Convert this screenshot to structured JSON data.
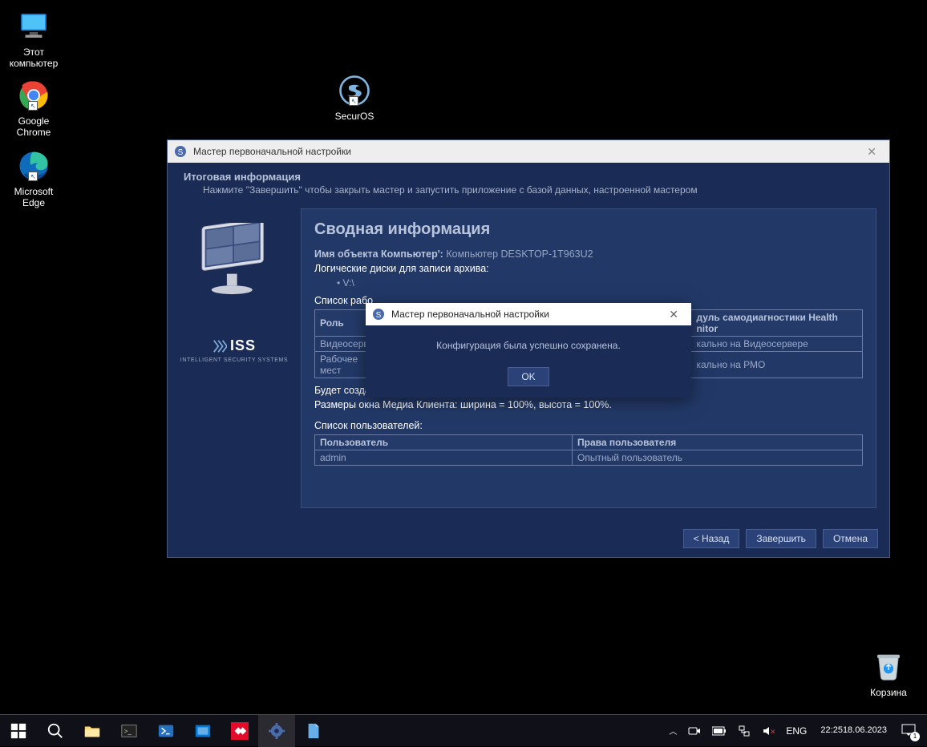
{
  "desktop": {
    "icons": [
      {
        "name": "this-pc",
        "label": "Этот\nкомпьютер"
      },
      {
        "name": "chrome",
        "label": "Google\nChrome"
      },
      {
        "name": "edge",
        "label": "Microsoft\nEdge"
      },
      {
        "name": "securos",
        "label": "SecurOS"
      }
    ],
    "recycle_label": "Корзина"
  },
  "wizard": {
    "window_title": "Мастер первоначальной настройки",
    "header_title": "Итоговая информация",
    "header_desc": "Нажмите \"Завершить\" чтобы закрыть мастер и запустить приложение с базой данных, настроенной мастером",
    "brand": "ISS",
    "brand_sub": "INTELLIGENT SECURITY SYSTEMS",
    "summary_title": "Сводная информация",
    "computer_name_label": "Имя объекта Компьютер':",
    "computer_name_value": "Компьютер DESKTOP-1T963U2",
    "drives_label": "Логические диски для записи архива:",
    "drives_value": "V:\\",
    "roles_label": "Список рабо",
    "roles_table": {
      "headers": [
        "Роль",
        "",
        "дуль самодиагностики Health\nnitor"
      ],
      "rows": [
        [
          "Видеосервер",
          "",
          "кально на Видеосервере"
        ],
        [
          "Рабочее мест",
          "",
          "кально на РМО"
        ]
      ]
    },
    "media_client_line1": "Будет создан Медиа Клиент со всеми сконфигурированными Камерами.",
    "media_client_line2": "Размеры окна Медиа Клиента: ширина = 100%, высота = 100%.",
    "users_label": "Список пользователей:",
    "users_table": {
      "headers": [
        "Пользователь",
        "Права пользователя"
      ],
      "rows": [
        [
          "admin",
          "Опытный пользователь"
        ]
      ]
    },
    "buttons": {
      "back": "< Назад",
      "finish": "Завершить",
      "cancel": "Отмена"
    }
  },
  "modal": {
    "title": "Мастер первоначальной настройки",
    "message": "Конфигурация была успешно сохранена.",
    "ok": "OK"
  },
  "taskbar": {
    "lang": "ENG",
    "time": "22:25",
    "date": "18.06.2023",
    "notif_count": "1"
  }
}
